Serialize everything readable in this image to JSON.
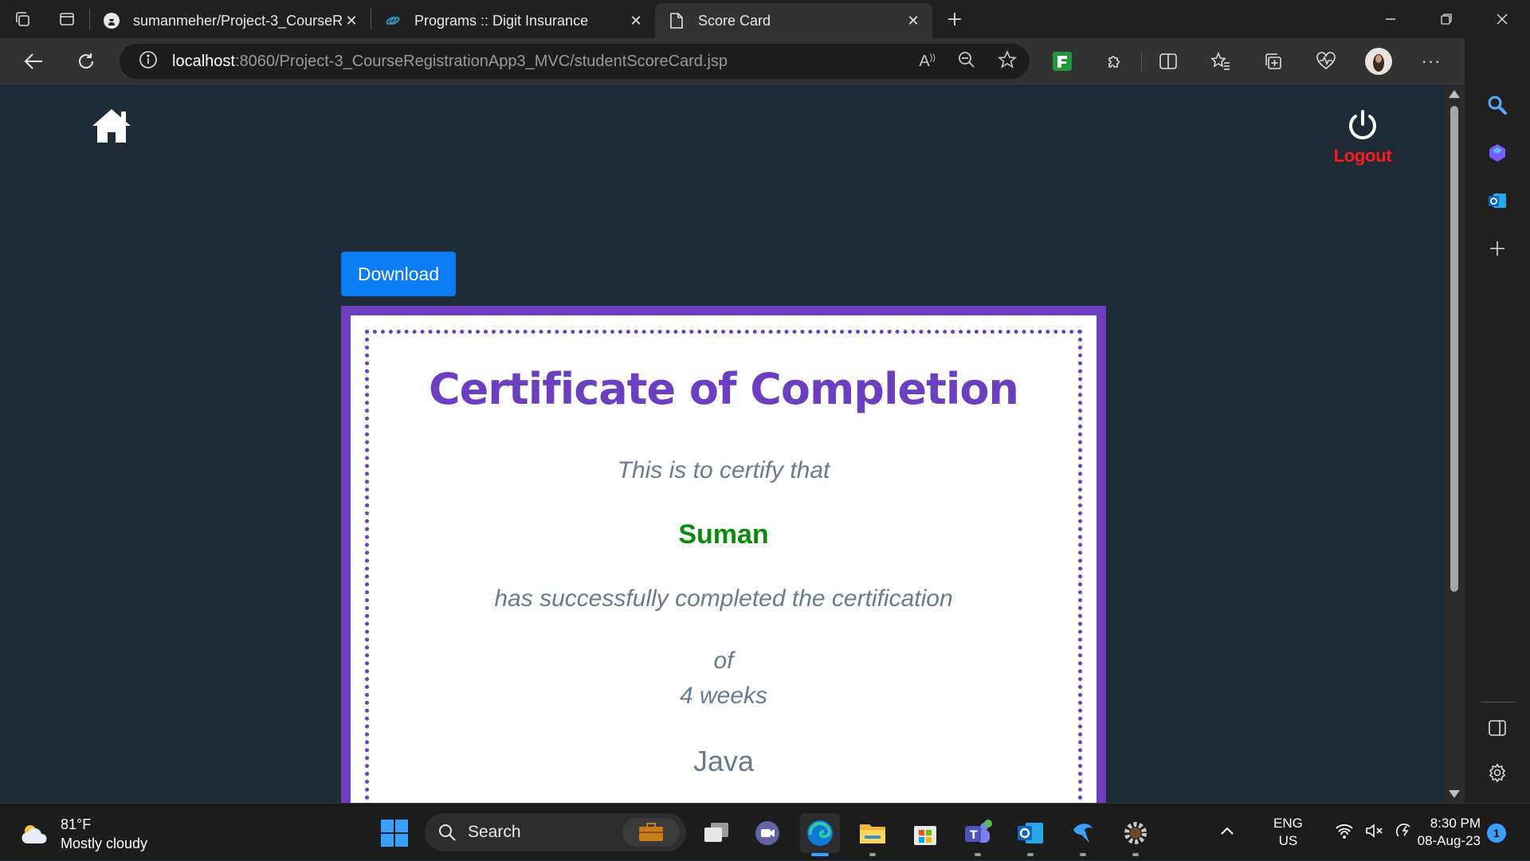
{
  "browser": {
    "tabs": [
      {
        "title": "sumanmeher/Project-3_CourseRe",
        "favicon": "github-icon",
        "active": false
      },
      {
        "title": "Programs :: Digit Insurance",
        "favicon": "link-icon",
        "active": false
      },
      {
        "title": "Score Card",
        "favicon": "page-icon",
        "active": true
      }
    ],
    "url_host": "localhost",
    "url_rest": ":8060/Project-3_CourseRegistrationApp3_MVC/studentScoreCard.jsp"
  },
  "page": {
    "logout_label": "Logout",
    "download_label": "Download",
    "certificate": {
      "title": "Certificate of Completion",
      "line1": "This is to certify that",
      "name": "Suman",
      "line2": "has successfully completed the certification",
      "line3": "of",
      "duration": "4 weeks",
      "course": "Java"
    },
    "colors": {
      "accent_purple": "#6c3fc1",
      "name_green": "#0a8a0a",
      "logout_red": "#ff1a1a",
      "download_blue": "#0d7cf2"
    }
  },
  "taskbar": {
    "weather_temp": "81°F",
    "weather_desc": "Mostly cloudy",
    "search_label": "Search",
    "lang_top": "ENG",
    "lang_bottom": "US",
    "time": "8:30 PM",
    "date": "08-Aug-23",
    "notification_count": "1"
  }
}
